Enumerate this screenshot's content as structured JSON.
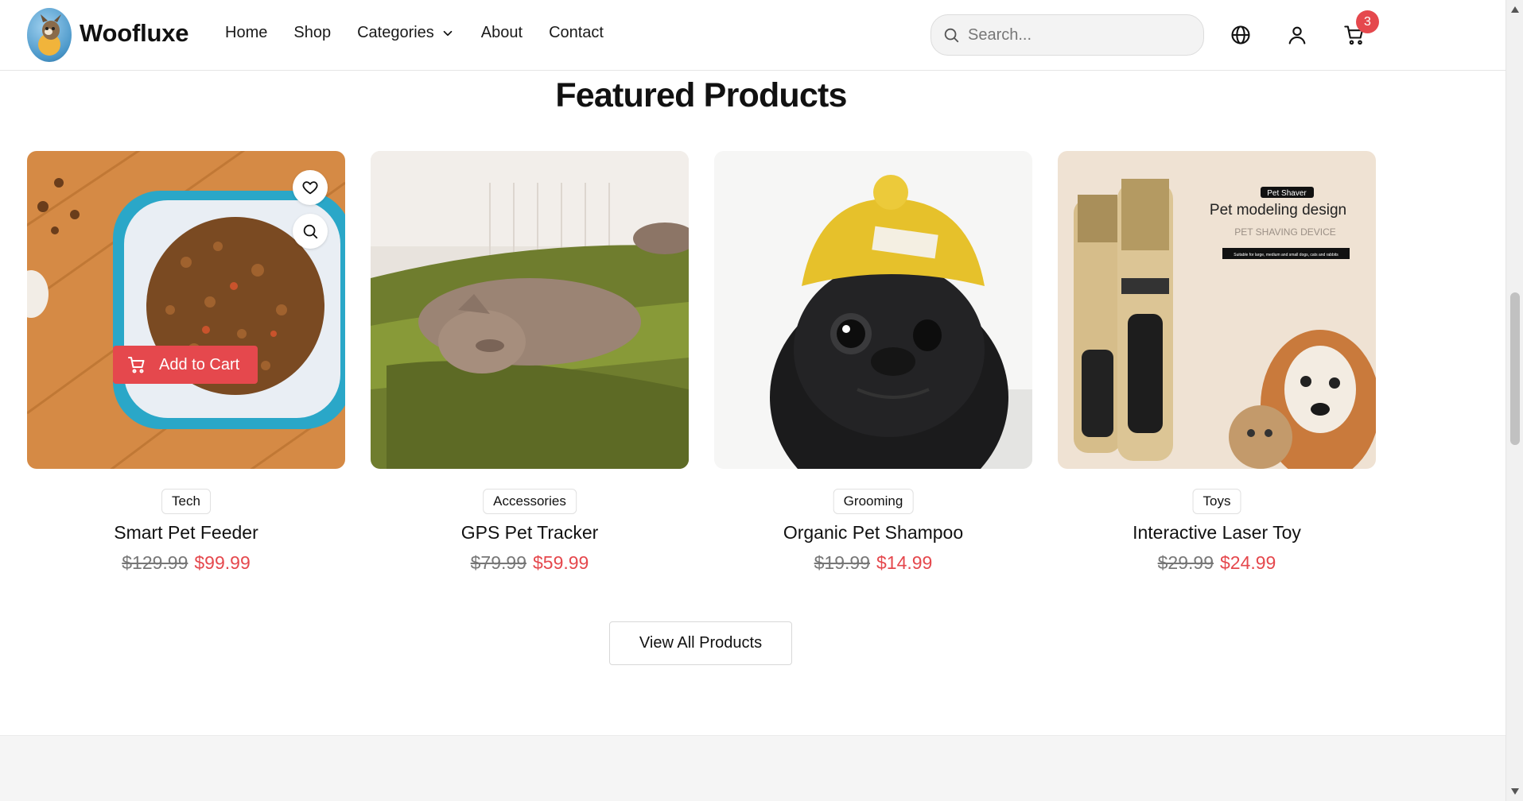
{
  "header": {
    "brand": "Woofluxe",
    "nav": [
      {
        "label": "Home"
      },
      {
        "label": "Shop"
      },
      {
        "label": "Categories"
      },
      {
        "label": "About"
      },
      {
        "label": "Contact"
      }
    ],
    "search_placeholder": "Search...",
    "cart_count": "3",
    "icons": [
      "globe-icon",
      "user-icon",
      "cart-icon"
    ]
  },
  "section": {
    "title": "Featured Products"
  },
  "products": [
    {
      "category": "Tech",
      "name": "Smart Pet Feeder",
      "old_price": "$129.99",
      "price": "$99.99",
      "add_to_cart": "Add to Cart"
    },
    {
      "category": "Accessories",
      "name": "GPS Pet Tracker",
      "old_price": "$79.99",
      "price": "$59.99"
    },
    {
      "category": "Grooming",
      "name": "Organic Pet Shampoo",
      "old_price": "$19.99",
      "price": "$14.99"
    },
    {
      "category": "Toys",
      "name": "Interactive Laser Toy",
      "old_price": "$29.99",
      "price": "$24.99",
      "image_text": {
        "tag": "Pet Shaver",
        "headline": "Pet modeling design",
        "sub": "PET SHAVING DEVICE",
        "fine": "Suitable for large, medium and small dogs, cats and rabbits"
      }
    }
  ],
  "view_all_label": "View All Products",
  "colors": {
    "accent": "#e5484d",
    "border": "#e0e0e0",
    "footer_bg": "#f5f5f5"
  }
}
